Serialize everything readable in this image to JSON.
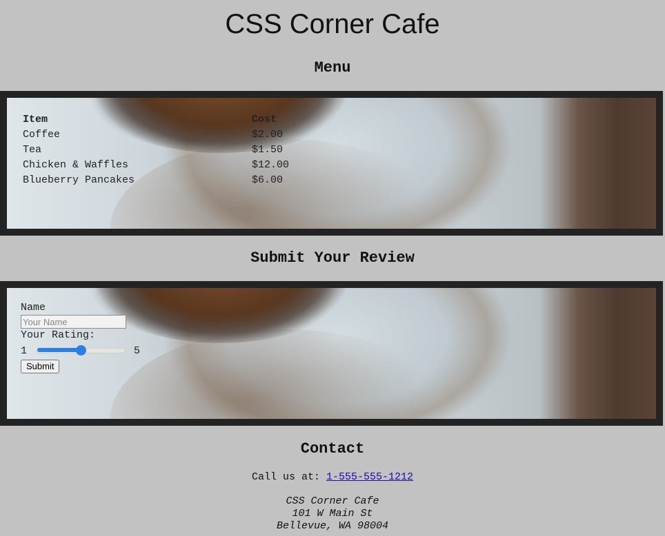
{
  "page": {
    "title": "CSS Corner Cafe"
  },
  "menu": {
    "heading": "Menu",
    "columns": [
      "Item",
      "Cost"
    ],
    "rows": [
      {
        "item": "Coffee",
        "cost": "$2.00"
      },
      {
        "item": "Tea",
        "cost": "$1.50"
      },
      {
        "item": "Chicken & Waffles",
        "cost": "$12.00"
      },
      {
        "item": "Blueberry Pancakes",
        "cost": "$6.00"
      }
    ]
  },
  "review": {
    "heading": "Submit Your Review",
    "name_label": "Name",
    "name_value": "",
    "name_placeholder": "Your Name",
    "rating_label": "Your Rating:",
    "rating_min": "1",
    "rating_max": "5",
    "rating_value": 3,
    "submit_label": "Submit",
    "accent_color": "#2d7de3"
  },
  "contact": {
    "heading": "Contact",
    "call_prefix": "Call us at:",
    "phone": "1-555-555-1212",
    "address_name": "CSS Corner Cafe",
    "address_street": "101 W Main St",
    "address_city": "Bellevue, WA 98004"
  },
  "colors": {
    "background": "#c2c2c2",
    "frame": "#232323",
    "link": "#1a0dab"
  }
}
